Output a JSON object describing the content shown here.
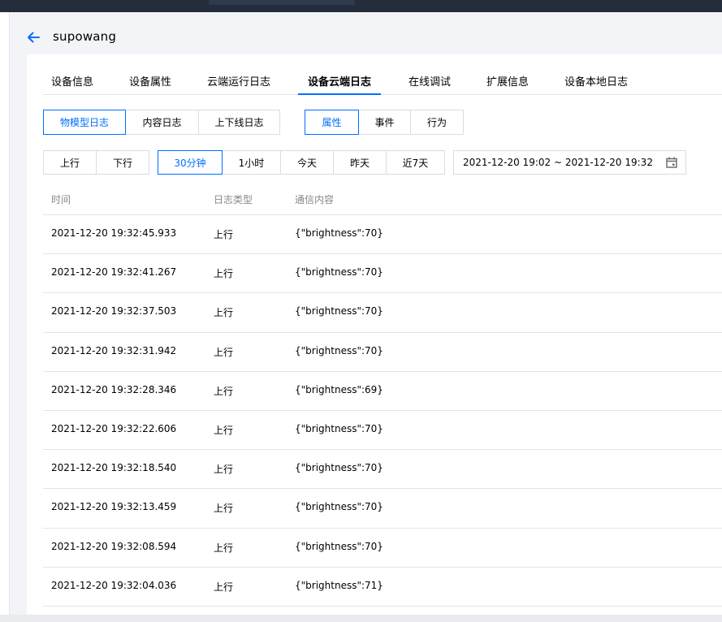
{
  "header": {
    "title": "supowang"
  },
  "tabs": [
    {
      "label": "设备信息"
    },
    {
      "label": "设备属性"
    },
    {
      "label": "云端运行日志"
    },
    {
      "label": "设备云端日志"
    },
    {
      "label": "在线调试"
    },
    {
      "label": "扩展信息"
    },
    {
      "label": "设备本地日志"
    }
  ],
  "active_tab": "设备云端日志",
  "log_types": [
    "物模型日志",
    "内容日志",
    "上下线日志"
  ],
  "log_type_selected": "物模型日志",
  "sub_types": [
    "属性",
    "事件",
    "行为"
  ],
  "sub_type_selected": "属性",
  "directions": [
    "上行",
    "下行"
  ],
  "time_ranges": [
    "30分钟",
    "1小时",
    "今天",
    "昨天",
    "近7天"
  ],
  "time_range_selected": "30分钟",
  "date_range": "2021-12-20 19:02 ~ 2021-12-20 19:32",
  "table": {
    "columns": [
      "时间",
      "日志类型",
      "通信内容"
    ],
    "rows": [
      [
        "2021-12-20 19:32:45.933",
        "上行",
        "{\"brightness\":70}"
      ],
      [
        "2021-12-20 19:32:41.267",
        "上行",
        "{\"brightness\":70}"
      ],
      [
        "2021-12-20 19:32:37.503",
        "上行",
        "{\"brightness\":70}"
      ],
      [
        "2021-12-20 19:32:31.942",
        "上行",
        "{\"brightness\":70}"
      ],
      [
        "2021-12-20 19:32:28.346",
        "上行",
        "{\"brightness\":69}"
      ],
      [
        "2021-12-20 19:32:22.606",
        "上行",
        "{\"brightness\":70}"
      ],
      [
        "2021-12-20 19:32:18.540",
        "上行",
        "{\"brightness\":70}"
      ],
      [
        "2021-12-20 19:32:13.459",
        "上行",
        "{\"brightness\":70}"
      ],
      [
        "2021-12-20 19:32:08.594",
        "上行",
        "{\"brightness\":70}"
      ],
      [
        "2021-12-20 19:32:04.036",
        "上行",
        "{\"brightness\":71}"
      ]
    ]
  },
  "colors": {
    "accent": "#006eff",
    "topbar": "#232d3c",
    "page_bg": "#f3f4f7",
    "border": "#dcdcdc"
  },
  "icons": {
    "back": "arrow-left-icon",
    "calendar": "calendar-icon"
  }
}
